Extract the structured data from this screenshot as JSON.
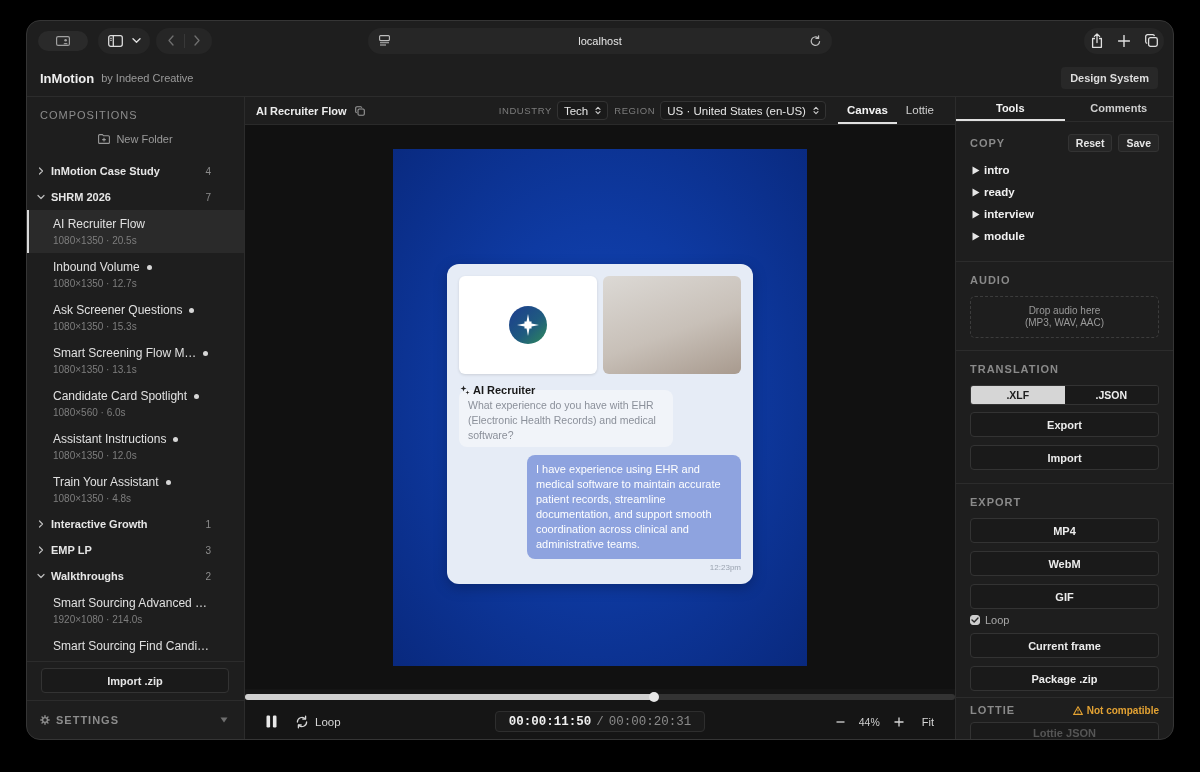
{
  "browser": {
    "url": "localhost"
  },
  "app": {
    "name": "InMotion",
    "byline": "by Indeed Creative",
    "design_system": "Design System"
  },
  "sidebar": {
    "title": "COMPOSITIONS",
    "new_folder": "New Folder",
    "folders": [
      {
        "name": "InMotion Case Study",
        "count": "4",
        "expanded": false
      },
      {
        "name": "SHRM 2026",
        "count": "7",
        "expanded": true,
        "children": [
          {
            "name": "AI Recruiter Flow",
            "meta": "1080×1350 · 20.5s",
            "selected": true,
            "modified": false
          },
          {
            "name": "Inbound Volume",
            "meta": "1080×1350 · 12.7s",
            "selected": false,
            "modified": true
          },
          {
            "name": "Ask Screener Questions",
            "meta": "1080×1350 · 15.3s",
            "selected": false,
            "modified": true
          },
          {
            "name": "Smart Screening Flow M…",
            "meta": "1080×1350 · 13.1s",
            "selected": false,
            "modified": true
          },
          {
            "name": "Candidate Card Spotlight",
            "meta": "1080×560 · 6.0s",
            "selected": false,
            "modified": true
          },
          {
            "name": "Assistant Instructions",
            "meta": "1080×1350 · 12.0s",
            "selected": false,
            "modified": true
          },
          {
            "name": "Train Your Assistant",
            "meta": "1080×1350 · 4.8s",
            "selected": false,
            "modified": true
          }
        ]
      },
      {
        "name": "Interactive Growth",
        "count": "1",
        "expanded": false
      },
      {
        "name": "EMP LP",
        "count": "3",
        "expanded": false
      },
      {
        "name": "Walkthroughs",
        "count": "2",
        "expanded": true,
        "children": [
          {
            "name": "Smart Sourcing Advanced …",
            "meta": "1920×1080 · 214.0s",
            "selected": false,
            "modified": false
          },
          {
            "name": "Smart Sourcing Find Candi…",
            "selected": false,
            "modified": false
          }
        ]
      }
    ],
    "import_button": "Import .zip",
    "settings": "SETTINGS"
  },
  "editor": {
    "title": "AI Recruiter Flow",
    "filters": [
      {
        "label": "INDUSTRY",
        "value": "Tech"
      },
      {
        "label": "REGION",
        "value": "US · United States (en-US)"
      }
    ],
    "view_tabs": [
      {
        "label": "Canvas",
        "selected": true
      },
      {
        "label": "Lottie",
        "selected": false
      }
    ]
  },
  "canvas": {
    "speaker": "AI Recruiter",
    "question": "What experience do you have with EHR (Electronic Health Records) and medical software?",
    "answer": "I have experience using EHR and medical software to maintain accurate patient records, streamline documentation, and support smooth coordination across clinical and administrative teams.",
    "timestamp": "12:23pm"
  },
  "playback": {
    "playing": true,
    "level": 0.576,
    "loop": "Loop",
    "current_time": "00:00:11:50",
    "separator": "/",
    "total_time": "00:00:20:31",
    "zoom": "44%",
    "fit": "Fit"
  },
  "panel": {
    "tabs": [
      {
        "label": "Tools",
        "selected": true
      },
      {
        "label": "Comments",
        "selected": false
      }
    ],
    "copy": {
      "title": "COPY",
      "actions": [
        "Reset",
        "Save"
      ],
      "items": [
        {
          "label": "intro",
          "expanded": false
        },
        {
          "label": "ready",
          "expanded": false
        },
        {
          "label": "interview",
          "expanded": false
        },
        {
          "label": "module",
          "expanded": false
        }
      ]
    },
    "audio": {
      "title": "AUDIO",
      "dropzone": "Drop audio here (MP3, WAV, AAC)"
    },
    "translation": {
      "title": "TRANSLATION",
      "formats": [
        {
          "label": ".XLF",
          "selected": true
        },
        {
          "label": ".JSON",
          "selected": false
        }
      ],
      "actions": [
        "Export",
        "Import"
      ]
    },
    "export": {
      "title": "EXPORT",
      "items": [
        {
          "kind": "button",
          "label": "MP4"
        },
        {
          "kind": "button",
          "label": "WebM"
        },
        {
          "kind": "button",
          "label": "GIF"
        },
        {
          "kind": "checkbox",
          "label": "Loop",
          "checked": true
        },
        {
          "kind": "button",
          "label": "Current frame"
        },
        {
          "kind": "button",
          "label": "Package .zip"
        }
      ]
    },
    "lottie": {
      "title": "LOTTIE",
      "warning": "Not compatible",
      "button": "Lottie JSON",
      "disabled": true
    }
  }
}
